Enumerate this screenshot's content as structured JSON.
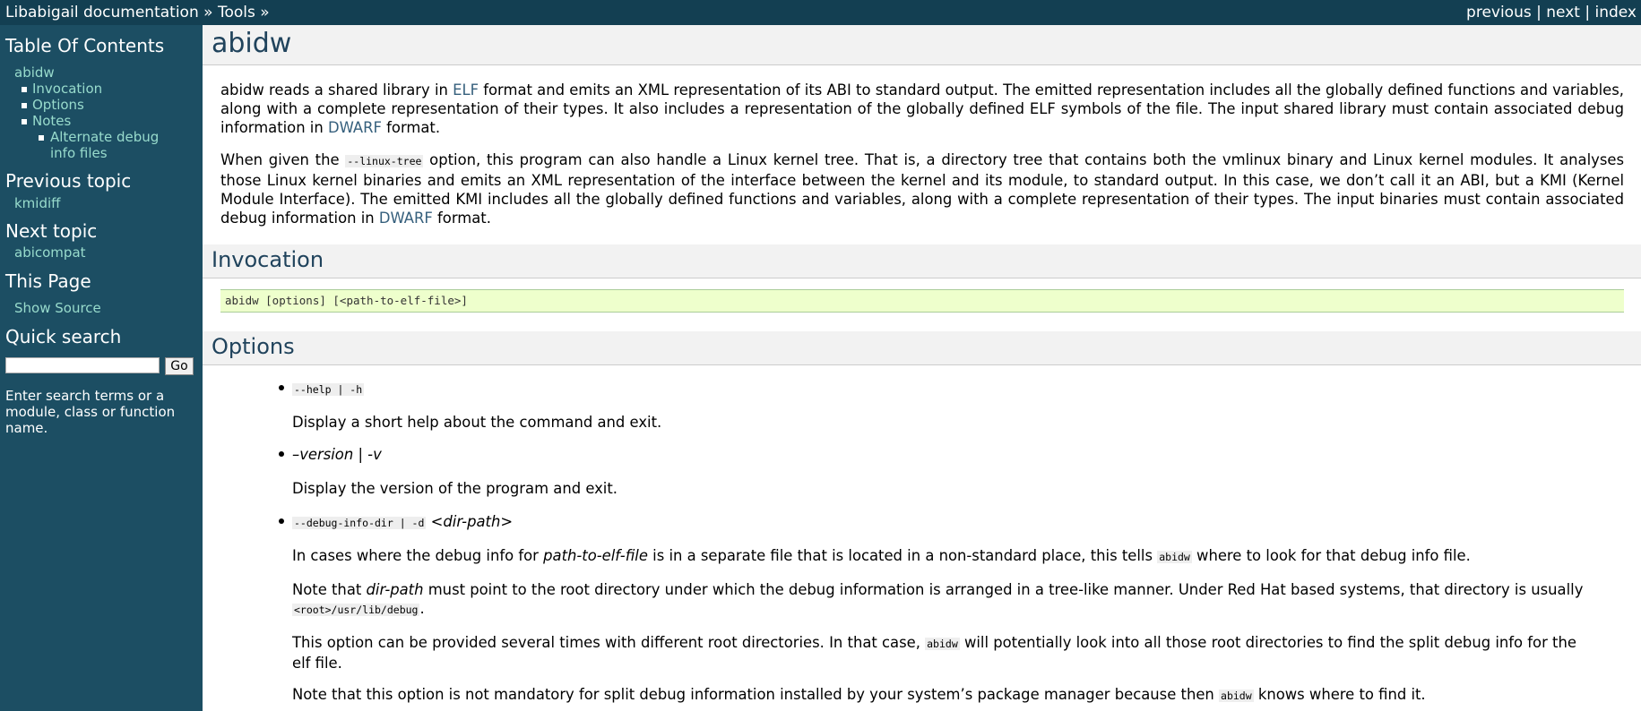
{
  "topbar": {
    "crumb_home": "Libabigail documentation",
    "sep1": " » ",
    "crumb_tools": "Tools",
    "sep2": " »",
    "previous": "previous",
    "next": "next",
    "index": "index",
    "divider": " | "
  },
  "sidebar": {
    "toc_title": "Table Of Contents",
    "toc": {
      "root": "abidw",
      "items": [
        "Invocation",
        "Options",
        "Notes"
      ],
      "subitem_line1": "Alternate debug",
      "subitem_line2": "info files"
    },
    "prev_title": "Previous topic",
    "prev_link": "kmidiff",
    "next_title": "Next topic",
    "next_link": "abicompat",
    "this_page_title": "This Page",
    "show_source": "Show Source",
    "search_title": "Quick search",
    "search_value": "",
    "go_label": "Go",
    "search_hint": "Enter search terms or a module, class or function name."
  },
  "main": {
    "title": "abidw",
    "p1": {
      "a": "abidw reads a shared library in ",
      "elf": "ELF",
      "b": " format and emits an XML representation of its ABI to standard output. The emitted representation includes all the globally defined functions and variables, along with a complete representation of their types. It also includes a representation of the globally defined ELF symbols of the file. The input shared library must contain associated debug information in ",
      "dwarf": "DWARF",
      "c": " format."
    },
    "p2": {
      "a": "When given the ",
      "code": "--linux-tree",
      "b": " option, this program can also handle a Linux kernel tree. That is, a directory tree that contains both the vmlinux binary and Linux kernel modules. It analyses those Linux kernel binaries and emits an XML representation of the interface between the kernel and its module, to standard output. In this case, we don’t call it an ABI, but a KMI (Kernel Module Interface). The emitted KMI includes all the globally defined functions and variables, along with a complete representation of their types. The input binaries must contain associated debug information in ",
      "dwarf": "DWARF",
      "c": " format."
    },
    "invocation_title": "Invocation",
    "invocation_code": "abidw [options] [<path-to-elf-file>]",
    "options_title": "Options",
    "options": {
      "help_code": "--help | -h",
      "help_desc": "Display a short help about the command and exit.",
      "version_text": "–version | -v",
      "version_desc": "Display the version of the program and exit.",
      "debug_code": "--debug-info-dir | -d",
      "debug_arg": "<dir-path>",
      "debug_d1_a": "In cases where the debug info for ",
      "debug_d1_em": "path-to-elf-file",
      "debug_d1_b": " is in a separate file that is located in a non-standard place, this tells ",
      "debug_d1_code": "abidw",
      "debug_d1_c": " where to look for that debug info file.",
      "debug_d2_a": "Note that ",
      "debug_d2_em": "dir-path",
      "debug_d2_b": " must point to the root directory under which the debug information is arranged in a tree-like manner. Under Red Hat based systems, that directory is usually ",
      "debug_d2_code": "<root>/usr/lib/debug",
      "debug_d2_c": ".",
      "debug_d3_a": "This option can be provided several times with different root directories. In that case, ",
      "debug_d3_code": "abidw",
      "debug_d3_b": " will potentially look into all those root directories to find the split debug info for the elf file.",
      "debug_d4_a": "Note that this option is not mandatory for split debug information installed by your system’s package manager because then ",
      "debug_d4_code": "abidw",
      "debug_d4_b": " knows where to find it."
    }
  }
}
